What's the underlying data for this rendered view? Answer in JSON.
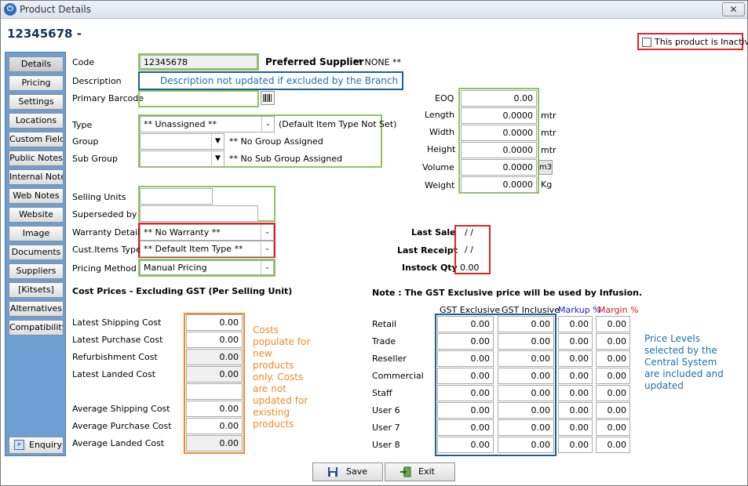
{
  "window": {
    "title": "Product Details",
    "close_glyph": "✕",
    "app_icon": "power-icon"
  },
  "heading": "12345678 -",
  "inactive_label": "This product is Inactive",
  "sidebar": {
    "items": [
      {
        "label": "Details"
      },
      {
        "label": "Pricing"
      },
      {
        "label": "Settings"
      },
      {
        "label": "Locations"
      },
      {
        "label": "Custom Fields"
      },
      {
        "label": "Public Notes"
      },
      {
        "label": "Internal Notes"
      },
      {
        "label": "Web Notes"
      },
      {
        "label": "Website"
      },
      {
        "label": "Image"
      },
      {
        "label": "Documents"
      },
      {
        "label": "Suppliers"
      },
      {
        "label": "[Kitsets]"
      },
      {
        "label": "Alternatives"
      },
      {
        "label": "Compatibility"
      }
    ],
    "enquiry": "Enquiry"
  },
  "form": {
    "code_label": "Code",
    "code_value": "12345678",
    "preferred_supplier_label": "Preferred Supplier",
    "preferred_supplier_value": "** NONE **",
    "description_label": "Description",
    "description_note": "Description not updated if excluded by the Branch",
    "barcode_label": "Primary Barcode",
    "type_label": "Type",
    "type_value": "** Unassigned **",
    "type_note": "(Default Item Type Not Set)",
    "group_label": "Group",
    "group_value": "** No Group Assigned",
    "subgroup_label": "Sub Group",
    "subgroup_value": "** No Sub Group Assigned",
    "selling_units_label": "Selling Units",
    "superseded_label": "Superseded by",
    "warranty_label": "Warranty Details",
    "warranty_value": "** No Warranty **",
    "cust_items_label": "Cust.Items Type",
    "cust_items_value": "** Default Item Type **",
    "pricing_method_label": "Pricing Method",
    "pricing_method_value": "Manual Pricing"
  },
  "dimensions": {
    "eoq": {
      "label": "EOQ",
      "value": "0.00"
    },
    "length": {
      "label": "Length",
      "value": "0.0000",
      "unit": "mtr"
    },
    "width": {
      "label": "Width",
      "value": "0.0000",
      "unit": "mtr"
    },
    "height": {
      "label": "Height",
      "value": "0.0000",
      "unit": "mtr"
    },
    "volume": {
      "label": "Volume",
      "value": "0.0000",
      "unit": "m3"
    },
    "weight": {
      "label": "Weight",
      "value": "0.0000",
      "unit": "Kg"
    }
  },
  "sales": {
    "last_sale_label": "Last Sale",
    "last_sale_value": "/ /",
    "last_receipt_label": "Last Receipt",
    "last_receipt_value": "/ /",
    "instock_label": "Instock Qty",
    "instock_value": "0.00"
  },
  "costs": {
    "heading": "Cost Prices - Excluding GST (Per Selling Unit)",
    "rows": [
      {
        "label": "Latest Shipping Cost",
        "value": "0.00"
      },
      {
        "label": "Latest Purchase Cost",
        "value": "0.00"
      },
      {
        "label": "Refurbishment Cost",
        "value": "0.00"
      },
      {
        "label": "Latest Landed Cost",
        "value": "0.00"
      }
    ],
    "avg_rows": [
      {
        "label": "Average Shipping Cost",
        "value": "0.00"
      },
      {
        "label": "Average Purchase Cost",
        "value": "0.00"
      },
      {
        "label": "Average Landed Cost",
        "value": "0.00"
      }
    ],
    "note": "Costs populate for new products only. Costs are not updated for existing products"
  },
  "prices": {
    "note": "Note : The GST Exclusive price will be used by Infusion.",
    "headers": {
      "gst_ex": "GST Exclusive",
      "gst_in": "GST Inclusive",
      "markup": "Markup %",
      "margin": "Margin %"
    },
    "markup_color": "#1a1ad0",
    "margin_color": "#d01a1a",
    "rows": [
      {
        "label": "Retail",
        "ex": "0.00",
        "inc": "0.00",
        "markup": "0.00",
        "margin": "0.00"
      },
      {
        "label": "Trade",
        "ex": "0.00",
        "inc": "0.00",
        "markup": "0.00",
        "margin": "0.00"
      },
      {
        "label": "Reseller",
        "ex": "0.00",
        "inc": "0.00",
        "markup": "0.00",
        "margin": "0.00"
      },
      {
        "label": "Commercial",
        "ex": "0.00",
        "inc": "0.00",
        "markup": "0.00",
        "margin": "0.00"
      },
      {
        "label": "Staff",
        "ex": "0.00",
        "inc": "0.00",
        "markup": "0.00",
        "margin": "0.00"
      },
      {
        "label": "User 6",
        "ex": "0.00",
        "inc": "0.00",
        "markup": "0.00",
        "margin": "0.00"
      },
      {
        "label": "User 7",
        "ex": "0.00",
        "inc": "0.00",
        "markup": "0.00",
        "margin": "0.00"
      },
      {
        "label": "User 8",
        "ex": "0.00",
        "inc": "0.00",
        "markup": "0.00",
        "margin": "0.00"
      }
    ],
    "levels_note": "Price Levels selected by the Central System are included and updated"
  },
  "footer": {
    "save": "Save",
    "exit": "Exit"
  },
  "colors": {
    "accent_green": "#8cc65a",
    "accent_red": "#e0232a",
    "accent_blue": "#1a5f98",
    "accent_orange": "#f08a2a",
    "sidebar": "#6d9fd2",
    "note_blue": "#1a72b0",
    "note_orange": "#f08a2a"
  }
}
